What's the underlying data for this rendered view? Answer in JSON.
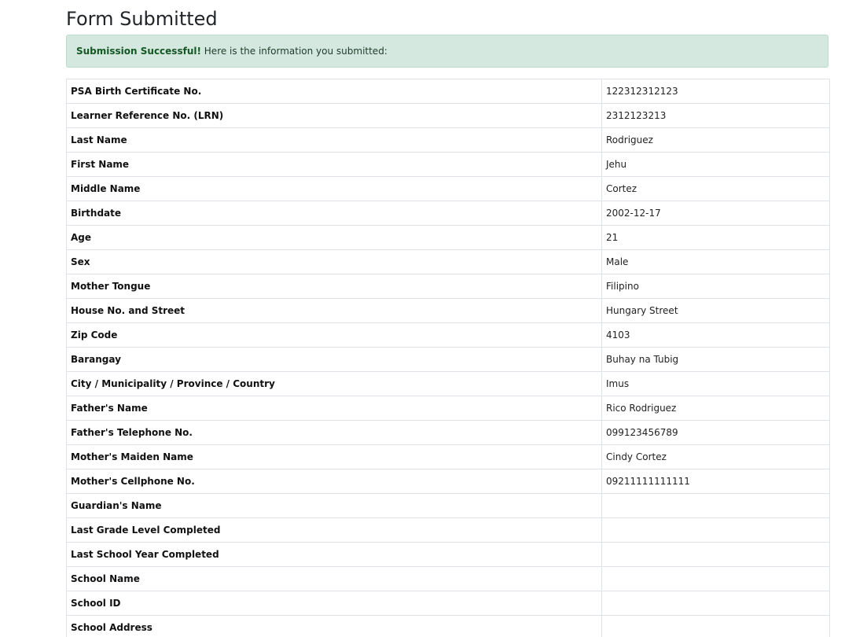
{
  "page_title": "Form Submitted",
  "alert": {
    "strong": "Submission Successful!",
    "message": "Here is the information you submitted:"
  },
  "rows": [
    {
      "label": "PSA Birth Certificate No.",
      "value": "122312312123"
    },
    {
      "label": "Learner Reference No. (LRN)",
      "value": "2312123213"
    },
    {
      "label": "Last Name",
      "value": "Rodriguez"
    },
    {
      "label": "First Name",
      "value": "Jehu"
    },
    {
      "label": "Middle Name",
      "value": "Cortez"
    },
    {
      "label": "Birthdate",
      "value": "2002-12-17"
    },
    {
      "label": "Age",
      "value": "21"
    },
    {
      "label": "Sex",
      "value": "Male"
    },
    {
      "label": "Mother Tongue",
      "value": "Filipino"
    },
    {
      "label": "House No. and Street",
      "value": "Hungary Street"
    },
    {
      "label": "Zip Code",
      "value": "4103"
    },
    {
      "label": "Barangay",
      "value": "Buhay na Tubig"
    },
    {
      "label": "City / Municipality / Province / Country",
      "value": "Imus"
    },
    {
      "label": "Father's Name",
      "value": "Rico Rodriguez"
    },
    {
      "label": "Father's Telephone No.",
      "value": "099123456789"
    },
    {
      "label": "Mother's Maiden Name",
      "value": "Cindy Cortez"
    },
    {
      "label": "Mother's Cellphone No.",
      "value": "09211111111111"
    },
    {
      "label": "Guardian's Name",
      "value": ""
    },
    {
      "label": "Last Grade Level Completed",
      "value": ""
    },
    {
      "label": "Last School Year Completed",
      "value": ""
    },
    {
      "label": "School Name",
      "value": ""
    },
    {
      "label": "School ID",
      "value": ""
    },
    {
      "label": "School Address",
      "value": ""
    }
  ]
}
